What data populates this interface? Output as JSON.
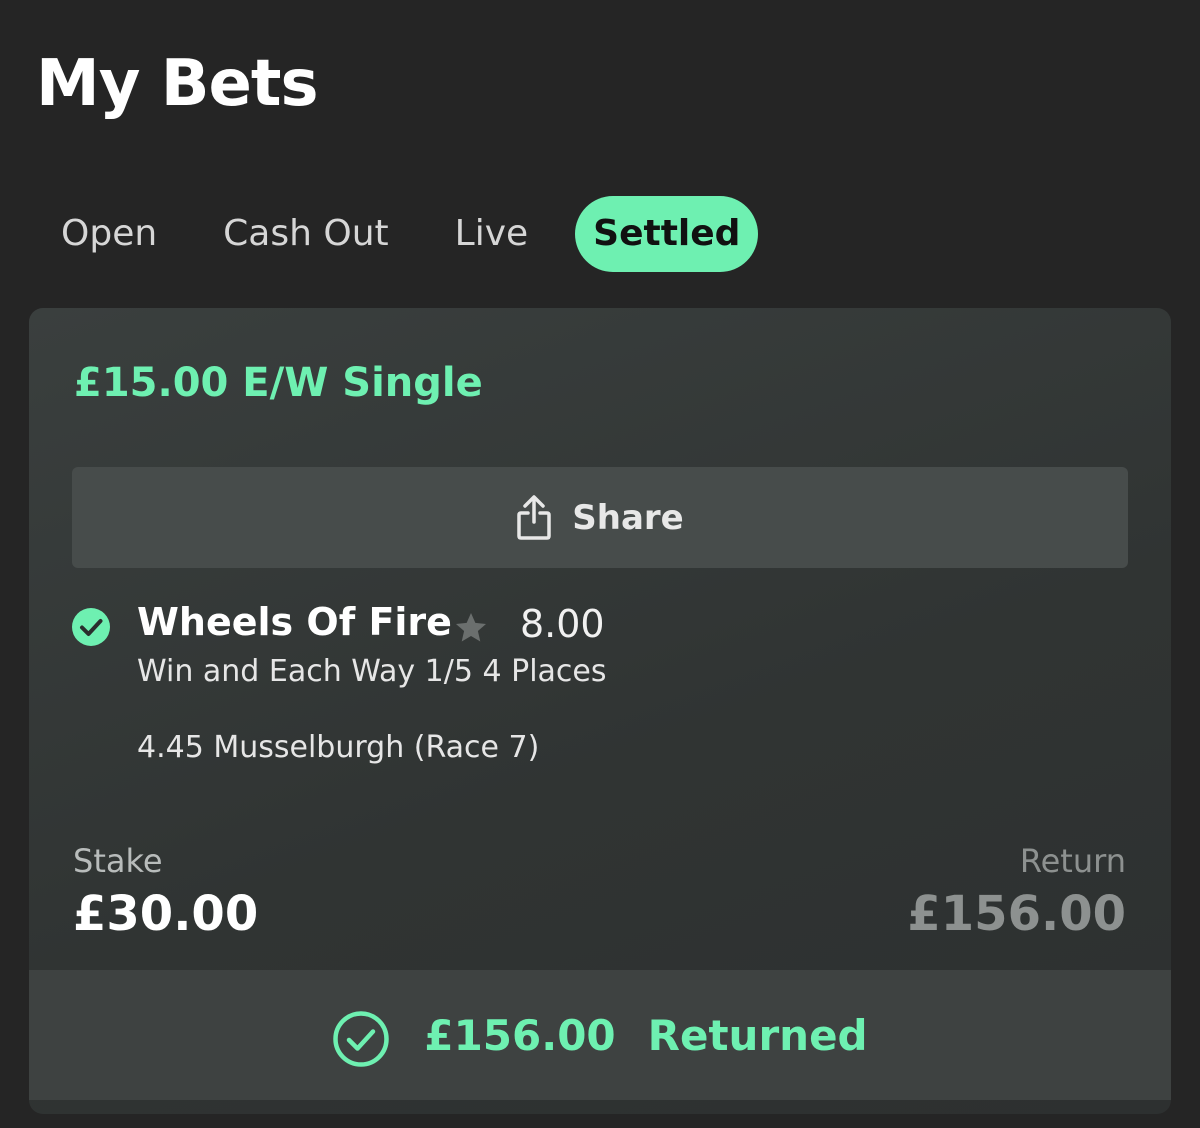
{
  "header": {
    "title": "My Bets"
  },
  "tabs": [
    {
      "label": "Open",
      "active": false
    },
    {
      "label": "Cash Out",
      "active": false
    },
    {
      "label": "Live",
      "active": false
    },
    {
      "label": "Settled",
      "active": true
    }
  ],
  "bet": {
    "title": "£15.00 E/W Single",
    "share_label": "Share",
    "selection": {
      "name": "Wheels Of Fire",
      "odds": "8.00",
      "market": "Win and Each Way 1/5 4 Places",
      "event": "4.45 Musselburgh (Race 7)",
      "status_icon": "check-circle-icon",
      "favourite_icon": "star-icon"
    },
    "stake_label": "Stake",
    "stake_value": "£30.00",
    "return_label": "Return",
    "return_value": "£156.00",
    "result_amount": "£156.00",
    "result_text": "Returned"
  },
  "colors": {
    "accent": "#6ef0b1",
    "background": "#252525",
    "card": "#333736"
  }
}
